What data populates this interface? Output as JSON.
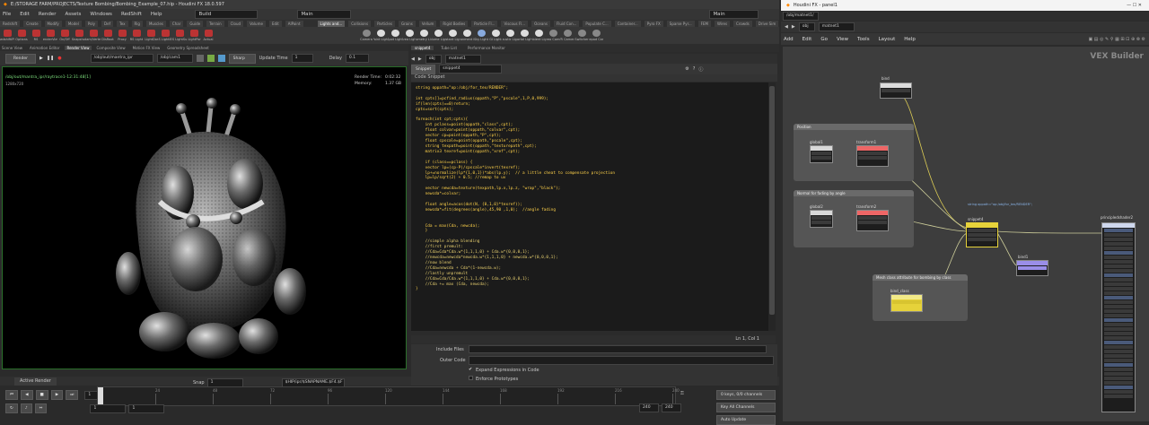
{
  "window": {
    "title": "E:/STORAGE FARM/PROJECTS/Texture Bombing/Bombing_Example_07.hip - Houdini FX 18.0.597",
    "desktop_build": "Build",
    "desktop_main": "Main",
    "desktop_main_right": "Main"
  },
  "menu": [
    "File",
    "Edit",
    "Render",
    "Assets",
    "Windows",
    "RedShift",
    "Help"
  ],
  "shelf_tabs_left": [
    "Redshift",
    "Create",
    "Modify",
    "Model",
    "Poly",
    "Def",
    "Tex",
    "Rig",
    "Muscles",
    "Char",
    "Guide",
    "Terrain",
    "Cloud",
    "Volume",
    "Edit",
    "AIPaint"
  ],
  "shelf_tabs_right": [
    "Lights and...",
    "Collisions",
    "Particles",
    "Grains",
    "Vellum",
    "Rigid Bodies",
    "Particle Fl...",
    "Viscous Fl...",
    "Oceans",
    "Fluid Con...",
    "Populate C...",
    "Container...",
    "Pyro FX",
    "Sparse Pyr...",
    "FEM",
    "Wires",
    "Crowds",
    "Drive Sim"
  ],
  "shelf_tools_left": [
    {
      "label": "RedshiftIPR",
      "color": "#b33"
    },
    {
      "label": "Options",
      "color": "#b33"
    },
    {
      "label": "RS",
      "color": "#b33"
    },
    {
      "label": "RenderView",
      "color": "#b33"
    },
    {
      "label": "On/Off",
      "color": "#b33"
    },
    {
      "label": "Snapshot",
      "color": "#b33"
    },
    {
      "label": "Cam/Vertex",
      "color": "#b33"
    },
    {
      "label": "DisRoot",
      "color": "#b33"
    },
    {
      "label": "Proxy",
      "color": "#b33"
    },
    {
      "label": "RS Light",
      "color": "#b33"
    },
    {
      "label": "RS LightDome",
      "color": "#b33"
    },
    {
      "label": "RS LightIES",
      "color": "#b33"
    },
    {
      "label": "RS LightSun",
      "color": "#b33"
    },
    {
      "label": "RS LightPortal",
      "color": "#b33"
    },
    {
      "label": "Actual",
      "color": "#b33"
    }
  ],
  "shelf_tools_right": [
    {
      "label": "Camera",
      "color": "#888"
    },
    {
      "label": "Point Light",
      "color": "#ddd"
    },
    {
      "label": "Spot Light",
      "color": "#ddd"
    },
    {
      "label": "Area Light",
      "color": "#ddd"
    },
    {
      "label": "Geometry Light",
      "color": "#ddd"
    },
    {
      "label": "Volume Light",
      "color": "#ddd"
    },
    {
      "label": "Distant Light",
      "color": "#ddd"
    },
    {
      "label": "Environment Light",
      "color": "#ddd"
    },
    {
      "label": "Sky Light",
      "color": "#8ad"
    },
    {
      "label": "GI Light",
      "color": "#ddd"
    },
    {
      "label": "Caustic Light",
      "color": "#ddd"
    },
    {
      "label": "Portal Light",
      "color": "#ddd"
    },
    {
      "label": "Ambient Light",
      "color": "#ddd"
    },
    {
      "label": "Stereo Camera",
      "color": "#888"
    },
    {
      "label": "VR Camera",
      "color": "#888"
    },
    {
      "label": "Switcher",
      "color": "#888"
    },
    {
      "label": "Gamepad Camera",
      "color": "#888"
    }
  ],
  "pane_tabs_left": [
    "Scene View",
    "Animation Editor",
    "Render View",
    "Composite View",
    "Motion FX View",
    "Geometry Spreadsheet"
  ],
  "pane_tabs_right": [
    "snippet4",
    "Tube List",
    "Performance Monitor"
  ],
  "viewport_toolbar": {
    "render_label": "Render",
    "camera_path": "/obj/out/mantra_ipr",
    "cam": "/obj/cam1",
    "sharp_label": "Sharp",
    "update_label": "Update Time",
    "update_value": "1",
    "delay_label": "Delay",
    "delay_value": "0.1"
  },
  "viewport": {
    "path_line": "/obj/out/mantra_ipr/raytrace1-12:31:48[1]",
    "resolution": "1280x720",
    "render_time_label": "Render Time:",
    "render_time": "0:02:32",
    "memory_label": "Memory:",
    "memory": "1.37 GB"
  },
  "code_editor": {
    "path_obj": "obj",
    "path_net": "matnet1",
    "tab_label": "Snippet",
    "node_name": "snippet4",
    "section_label": "Code Snippet",
    "lines": [
      "string oppath=\"op:/obj/for_tex/RENDER\";",
      "",
      "int cpts[]=pcfind_radius(oppath,\"P\",\"pscale\",1,P,0,999);",
      "if(len(cpts)==0)return;",
      "cpts=sort(cpts);",
      "",
      "foreach(int cpt;cpts){",
      "    int pclass=point(oppath,\"class\",cpt);",
      "    float colvar=point(oppath,\"colvar\",cpt);",
      "    vector cp=point(oppath,\"P\",cpt);",
      "    float cpscale=point(oppath,\"pscale\",cpt);",
      "    string texpath=point(oppath,\"texturepath\",cpt);",
      "    matrix3 texref=point(oppath,\"xref\",cpt);",
      "",
      "    if (class==pclass) {",
      "    vector lp=(cp-P)/cpscale*invert(texref);",
      "    lp+=normalize(lp*{1,0,1})*abs(lp.y);  // a little cheat to compensate projection",
      "    lp=lp/sqrt(2) + 0.5; //remap to uv",
      "",
      "    vector newcda=texture(texpath,lp.x,lp.z, \"wrap\",\"black\");",
      "    newcda*=colvar;",
      "",
      "    float angle=acos(dot(N, {0,1,0}*texref));",
      "    newcda*=fit(degrees(angle),45,90 ,1,0);  //angle fading",
      "",
      "",
      "    Cda = max(Cda, newcda);",
      "    }",
      "",
      "    //simple alpha blending",
      "    //first premult:",
      "    //Cda=Cda*Cda.w*{1,1,1,0} + Cda.w*{0,0,0,1};",
      "    //newcda=newcda*newcda.w*{1,1,1,0} + newcda.w*{0,0,0,1};",
      "    //now blend",
      "    //Cda=newcda + Cda*(1-newcda.w);",
      "    //lastly unpremult",
      "    //Cda=Cda/Cda.w*{1,1,1,0} + Cda.w*{0,0,0,1};",
      "    //Cda += max (Cda, newcda);",
      "}"
    ],
    "status": "Ln 1, Col 1"
  },
  "parms": {
    "include_files": "Include Files",
    "outer_code": "Outer Code",
    "expand_label": "Expand Expressions in Code",
    "enforce_label": "Enforce Prototypes"
  },
  "render_tab": "Active Render",
  "timeline": {
    "frame": "1",
    "ticks": [
      "1",
      "24",
      "48",
      "72",
      "96",
      "120",
      "144",
      "168",
      "192",
      "216",
      "240"
    ],
    "snap_label": "Snap",
    "snap_value": "1",
    "path_field": "$HIP/ipr/$SNAPNAME.$F4.$F",
    "start": "1",
    "start2": "1",
    "end": "240",
    "end2": "240",
    "keys_label": "0 keys, 0/0 channels",
    "keyall_label": "Key All Channels",
    "autoupdate_label": "Auto Update"
  },
  "node_editor": {
    "window_title": "Houdini FX - panel1",
    "tab": "/obj/matnet1/",
    "path_obj": "obj",
    "path_net": "matnet1",
    "menu": [
      "Add",
      "Edit",
      "Go",
      "View",
      "Tools",
      "Layout",
      "Help"
    ],
    "context_label": "VEX Builder",
    "boxes": [
      {
        "title": "Position"
      },
      {
        "title": "Normal for fading by angle"
      },
      {
        "title": "Mesh class attribute for bombing by class"
      }
    ],
    "nodes": [
      {
        "label": "bind"
      },
      {
        "label": "global1"
      },
      {
        "label": "transform1"
      },
      {
        "label": "global2"
      },
      {
        "label": "transform2"
      },
      {
        "label": "snippet4"
      },
      {
        "label": "bind_class"
      },
      {
        "label": "principledshader2"
      },
      {
        "label": "bind1"
      }
    ],
    "snippet_note": "string oppath=\"op:/obj/for_tex/RENDER\";"
  },
  "colors": {
    "code_text": "#ffd24a",
    "accent_green": "#2a6e2a",
    "vnode_yellow": "#e6d23a",
    "vnode_purple": "#9a8ee8"
  }
}
